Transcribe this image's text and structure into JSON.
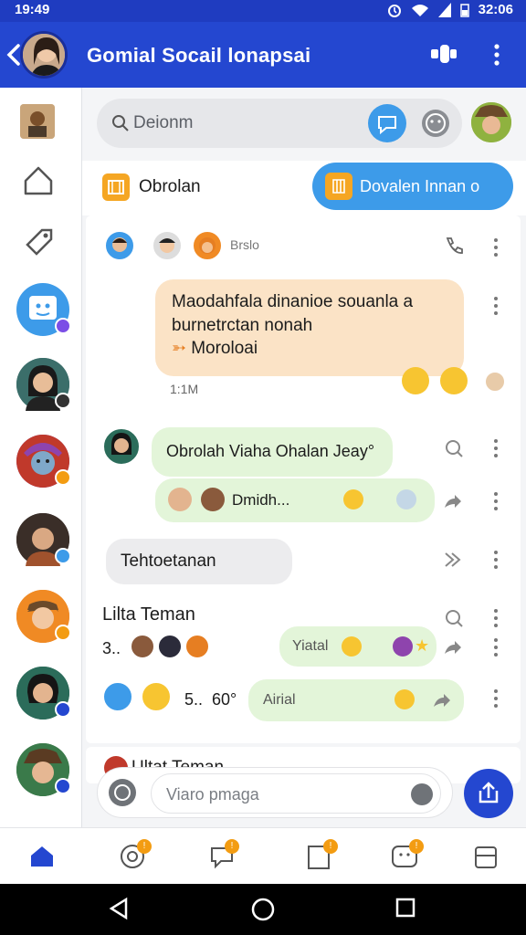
{
  "status_bar": {
    "time": "19:49",
    "right_text": "32:06"
  },
  "app_bar": {
    "title": "Gomial Socail lonapsai"
  },
  "search": {
    "placeholder": "Deionm"
  },
  "chats_header": {
    "label": "Obrolan",
    "action_label": "Dovalen Innan o"
  },
  "thread": {
    "group_label": "Brslo",
    "message1": {
      "line1": "Maodahfala dinanioe souanla a",
      "line2": "burnetrctan nonah",
      "line3": "Moroloai"
    },
    "time1": "1:1M",
    "message2": "Obrolah Viaha Ohalan Jeay°",
    "message2_reply": "Dmidh...",
    "message3": "Tehtoetanan",
    "section_title": "Lilta Teman",
    "row1_count": "3..",
    "row1_tag": "Yiatal",
    "row2_count": "5..",
    "row2_value": "60°",
    "row2_tag": "Airial",
    "partial_title": "Ultat Teman"
  },
  "compose": {
    "placeholder": "Viaro pmaga"
  },
  "colors": {
    "primary": "#2447d0",
    "statusbar": "#1f3cc0",
    "accent_blue": "#3d9be9",
    "peach": "#fbe3c6",
    "green": "#e3f5d9",
    "badge": "#f39c12"
  },
  "icons": [
    "back-arrow-icon",
    "call-icon",
    "more-vert-icon",
    "search-icon",
    "chat-icon",
    "emoji-icon",
    "home-icon",
    "tag-icon",
    "phone-icon",
    "reply-icon",
    "forward-icon",
    "upload-icon",
    "nav-back-icon",
    "nav-home-icon",
    "nav-recents-icon"
  ]
}
